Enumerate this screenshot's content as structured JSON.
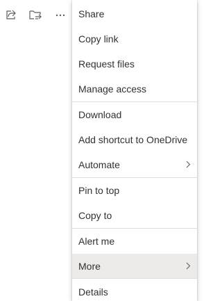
{
  "toolbar": {
    "icons": [
      "share-icon",
      "move-to-icon",
      "more-icon"
    ]
  },
  "menu": {
    "items": [
      {
        "label": "Share"
      },
      {
        "label": "Copy link"
      },
      {
        "label": "Request files"
      },
      {
        "label": "Manage access"
      },
      {
        "label": "Download"
      },
      {
        "label": "Add shortcut to OneDrive"
      },
      {
        "label": "Automate",
        "submenu": true
      },
      {
        "label": "Pin to top"
      },
      {
        "label": "Copy to"
      },
      {
        "label": "Alert me"
      },
      {
        "label": "More",
        "submenu": true,
        "highlighted": true
      },
      {
        "label": "Details"
      }
    ]
  },
  "colors": {
    "text": "#323130",
    "icon": "#605e5c",
    "highlight": "#edebe9",
    "divider": "#e1dfdd"
  }
}
